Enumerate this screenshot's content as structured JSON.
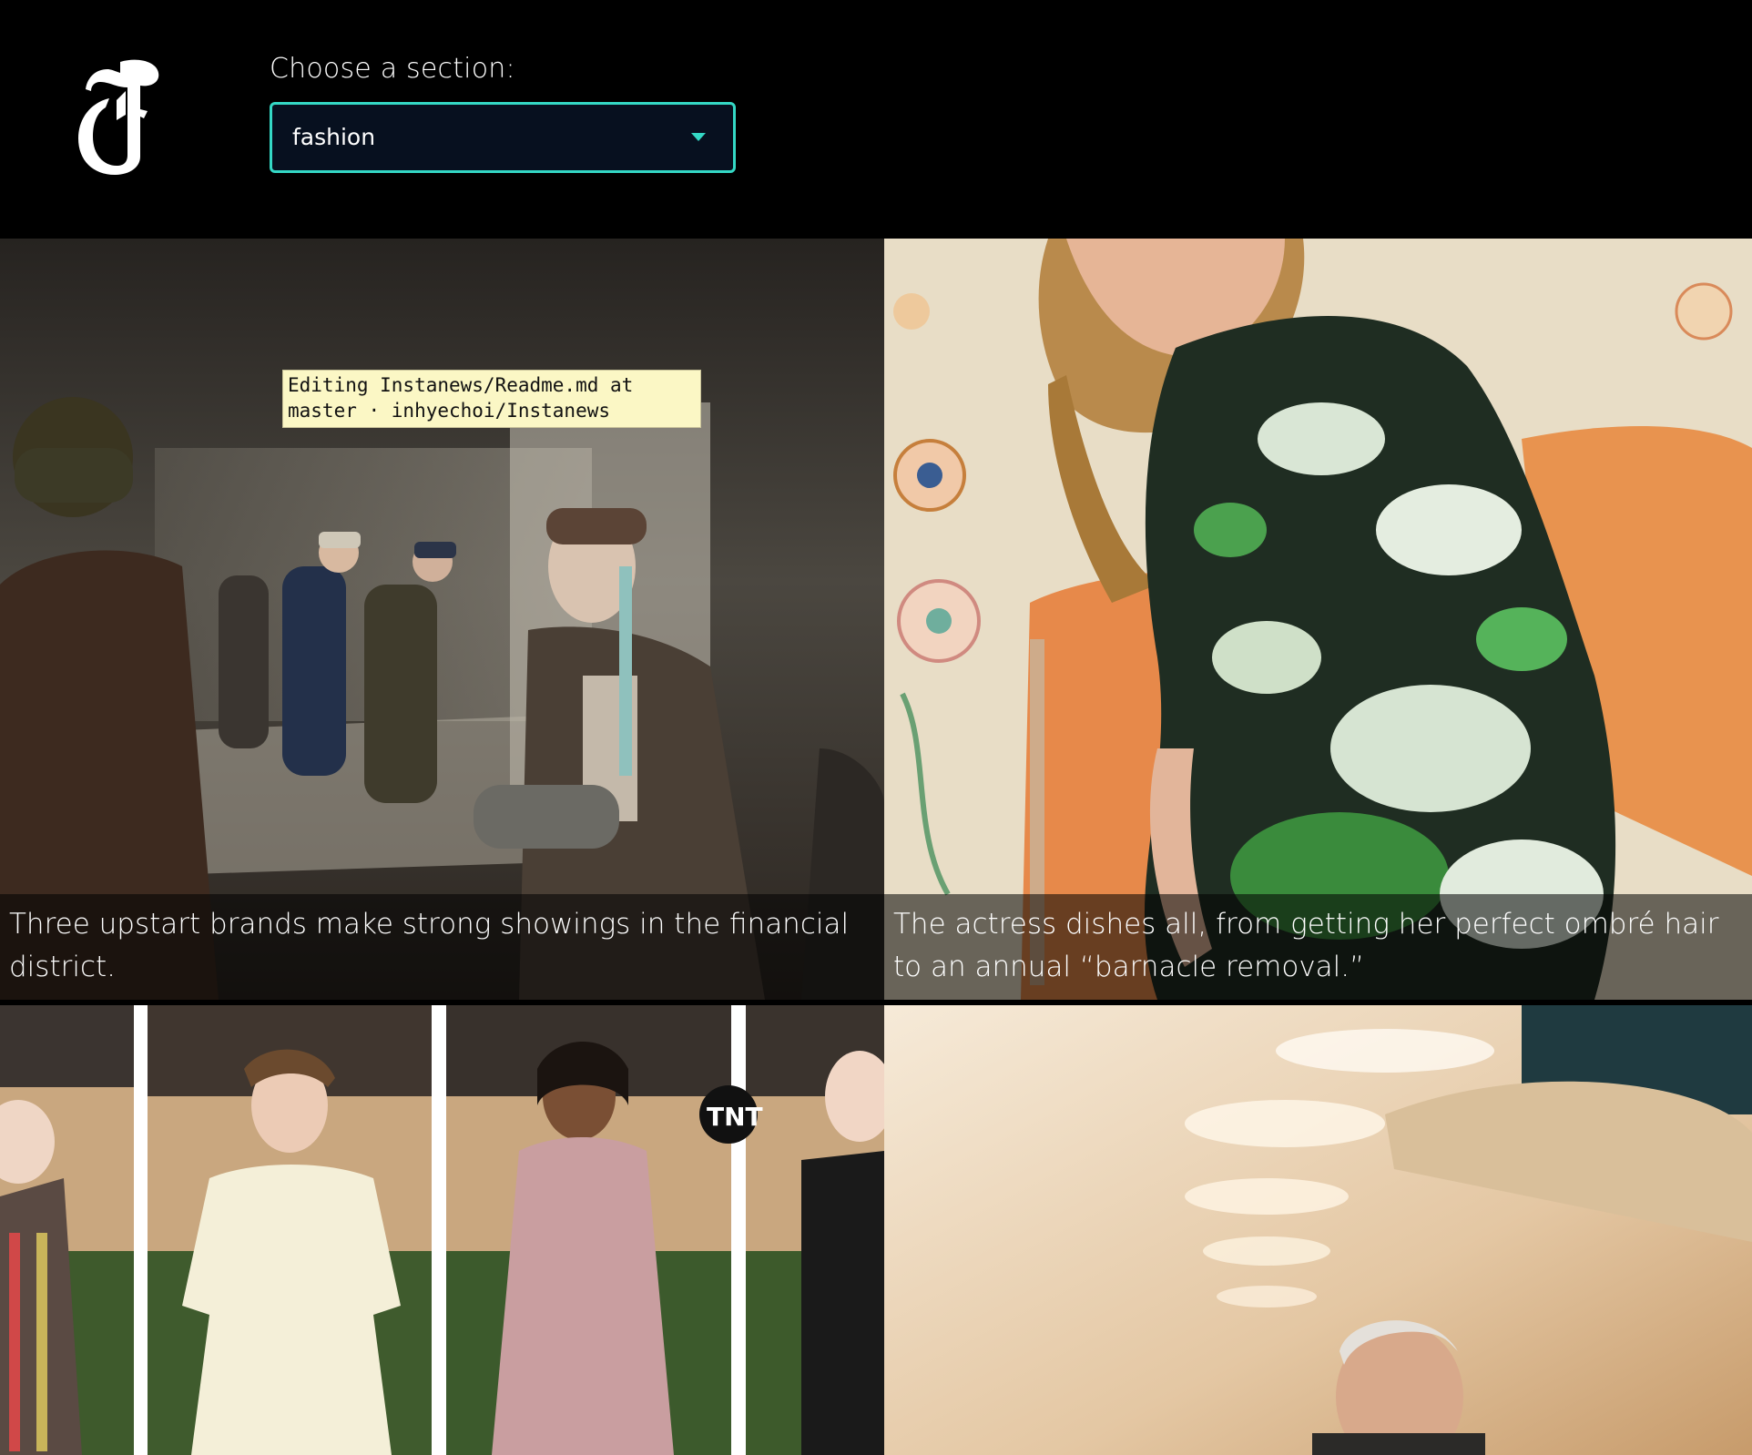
{
  "header": {
    "logo_alt": "T",
    "section_label": "Choose a section:",
    "section_select": {
      "value": "fashion"
    }
  },
  "tooltip": {
    "text": "Editing Instanews/Readme.md at master · inhyechoi/Instanews"
  },
  "articles": [
    {
      "caption": "Three upstart brands make strong showings in the financial district.",
      "image": "runway-models-photo"
    },
    {
      "caption": "The actress dishes all, from getting her perfect ombré hair to an annual “barnacle removal.”",
      "image": "woman-floral-dress-photo"
    },
    {
      "caption": "",
      "image": "red-carpet-collage-photo"
    },
    {
      "caption": "",
      "image": "man-in-restaurant-photo"
    }
  ],
  "colors": {
    "accent": "#34d8c5",
    "background": "#000000",
    "select_bg": "#07101f"
  }
}
